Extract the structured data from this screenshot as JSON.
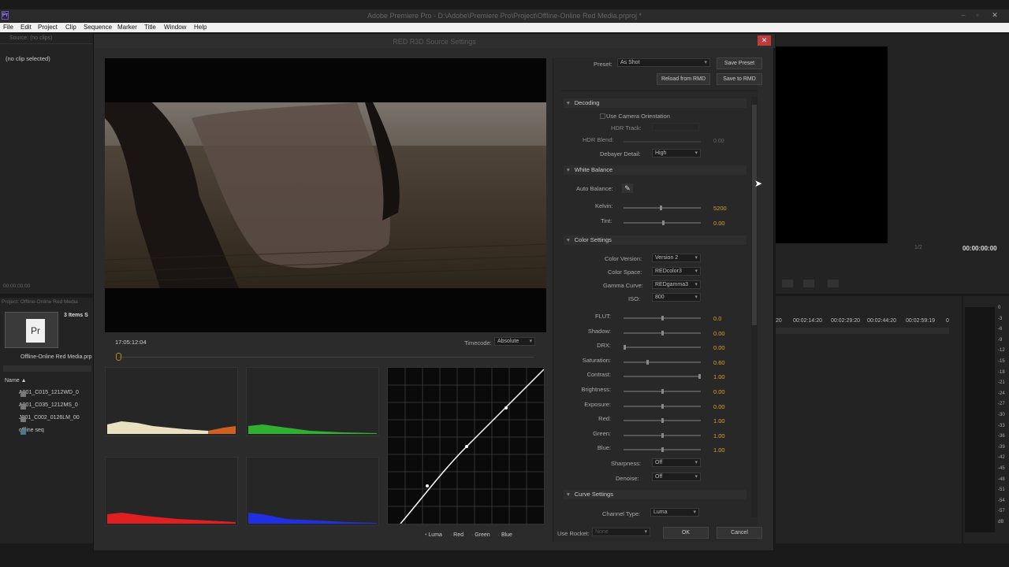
{
  "app": {
    "title": "Adobe Premiere Pro - D:\\Adobe\\Premiere Pro\\Project\\Offline-Online Red Media.prproj *",
    "icon_label": "Pr",
    "menu": [
      "File",
      "Edit",
      "Project",
      "Clip",
      "Sequence",
      "Marker",
      "Title",
      "Window",
      "Help"
    ]
  },
  "source_panel": {
    "tab": "Source: (no clips)",
    "no_clip": "(no clip selected)",
    "timecode": "00:00:00:00"
  },
  "project_panel": {
    "tab": "Project: Offline-Online Red Media",
    "items_count": "3 Items S",
    "project_file": "Offline-Online Red Media.prp",
    "thumb_label": "Pr",
    "col_name": "Name",
    "items": [
      "A001_C015_1212WD_0",
      "A001_C035_1212MS_0",
      "J001_C002_0126LM_00",
      "offline seq"
    ]
  },
  "program_panel": {
    "timecode": "00:00:00:00",
    "fraction": "1/2"
  },
  "timeline": {
    "ruler": [
      "20",
      "00:02:14:20",
      "00:02:29:20",
      "00:02:44:20",
      "00:02:59:19",
      "0"
    ]
  },
  "meter": {
    "scale": [
      "0",
      "-3",
      "-6",
      "-9",
      "-12",
      "-15",
      "-18",
      "-21",
      "-24",
      "-27",
      "-30",
      "-33",
      "-36",
      "-39",
      "-42",
      "-45",
      "-48",
      "-51",
      "-54",
      "-57",
      "dB"
    ]
  },
  "dialog": {
    "title": "RED R3D Source Settings",
    "close_icon": "close-icon",
    "preview": {
      "timecode": "17:05:12:04",
      "timecode_label": "Timecode:",
      "timecode_mode": "Absolute"
    },
    "curve_channels": [
      "Luma",
      "Red",
      "Green",
      "Blue"
    ],
    "preset_label": "Preset:",
    "preset_value": "As Shot",
    "save_preset": "Save Preset",
    "reload_rmd": "Reload from RMD",
    "save_rmd": "Save to RMD",
    "decoding": {
      "header": "Decoding",
      "use_orientation": "Use Camera Orientation",
      "hdr_track": "HDR Track:",
      "hdr_blend": "HDR Blend:",
      "hdr_blend_value": "0.00",
      "debayer_label": "Debayer Detail:",
      "debayer_value": "High"
    },
    "white_balance": {
      "header": "White Balance",
      "auto_balance": "Auto Balance:",
      "kelvin_label": "Kelvin:",
      "kelvin_value": "5200",
      "tint_label": "Tint:",
      "tint_value": "0.00"
    },
    "color_settings": {
      "header": "Color Settings",
      "color_version_label": "Color Version:",
      "color_version": "Version 2",
      "color_space_label": "Color Space:",
      "color_space": "REDcolor3",
      "gamma_label": "Gamma Curve:",
      "gamma": "REDgamma3",
      "iso_label": "ISO:",
      "iso": "800",
      "sliders": [
        {
          "label": "FLUT:",
          "value": "0.0",
          "pos": 0.5
        },
        {
          "label": "Shadow:",
          "value": "0.00",
          "pos": 0.5
        },
        {
          "label": "DRX:",
          "value": "0.00",
          "pos": 0.0
        },
        {
          "label": "Saturation:",
          "value": "0.60",
          "pos": 0.3
        },
        {
          "label": "Contrast:",
          "value": "1.00",
          "pos": 1.0
        },
        {
          "label": "Brightness:",
          "value": "0.00",
          "pos": 0.5
        },
        {
          "label": "Exposure:",
          "value": "0.00",
          "pos": 0.5
        },
        {
          "label": "Red:",
          "value": "1.00",
          "pos": 0.5
        },
        {
          "label": "Green:",
          "value": "1.00",
          "pos": 0.5
        },
        {
          "label": "Blue:",
          "value": "1.00",
          "pos": 0.5
        }
      ],
      "sharpness_label": "Sharpness:",
      "sharpness": "Off",
      "denoise_label": "Denoise:",
      "denoise": "Off"
    },
    "curve_settings": {
      "header": "Curve Settings",
      "channel_type_label": "Channel Type:",
      "channel_type": "Luma"
    },
    "use_rocket_label": "Use Rocket:",
    "use_rocket_value": "None",
    "ok": "OK",
    "cancel": "Cancel"
  }
}
